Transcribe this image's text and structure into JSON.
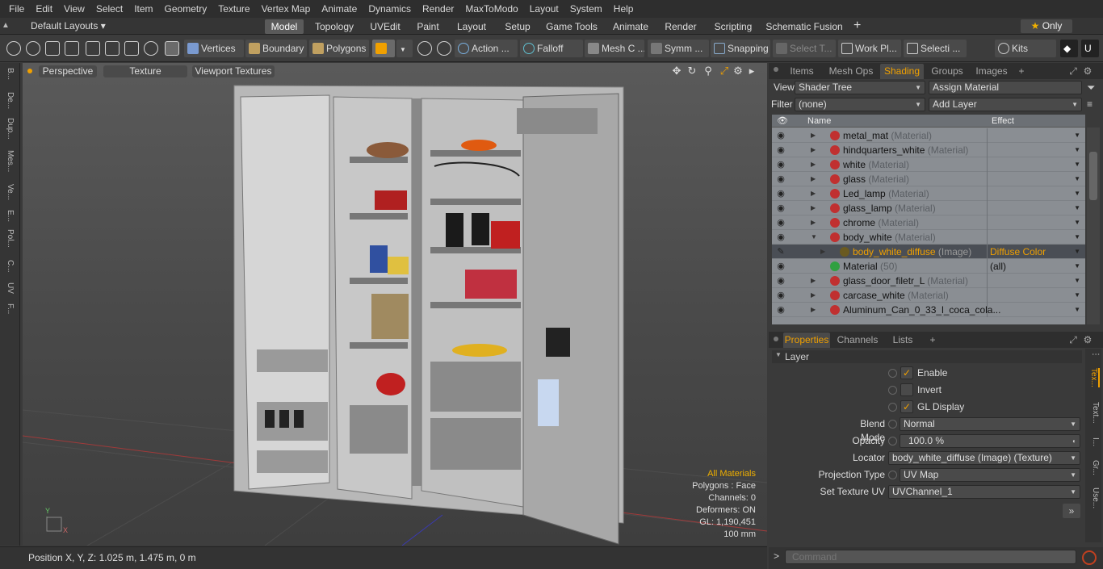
{
  "menu": [
    "File",
    "Edit",
    "View",
    "Select",
    "Item",
    "Geometry",
    "Texture",
    "Vertex Map",
    "Animate",
    "Dynamics",
    "Render",
    "MaxToModo",
    "Layout",
    "System",
    "Help"
  ],
  "layout": {
    "default_label": "Default Layouts ▾",
    "tabs": [
      "Model",
      "Topology",
      "UVEdit",
      "Paint",
      "Layout",
      "Setup",
      "Game Tools",
      "Animate",
      "Render",
      "Scripting",
      "Schematic Fusion"
    ],
    "active_tab": "Model",
    "only_label": "Only"
  },
  "toolbar": {
    "vertices": "Vertices",
    "boundary": "Boundary",
    "polygons": "Polygons",
    "action": "Action",
    "falloff": "Falloff",
    "mesh": "Mesh C ...",
    "symm": "Symm ...",
    "snapping": "Snapping",
    "select_t": "Select T...",
    "work_pl": "Work Pl...",
    "selecti": "Selecti ...",
    "kits": "Kits"
  },
  "left_tabs": [
    "B...",
    "De...",
    "Dup...",
    "Mes...",
    "Ve...",
    "E...",
    "Pol...",
    "C...",
    "UV",
    "F..."
  ],
  "viewport": {
    "perspective": "Perspective",
    "texture": "Texture",
    "viewport_textures": "Viewport Textures",
    "stats": {
      "all_materials": "All Materials",
      "polygons": "Polygons : Face",
      "channels": "Channels: 0",
      "deformers": "Deformers: ON",
      "gl": "GL: 1,190,451",
      "unit": "100 mm"
    }
  },
  "status": {
    "position": "Position X, Y, Z:   1.025 m, 1.475 m, 0 m"
  },
  "shading_panel": {
    "tabs": [
      "Items",
      "Mesh Ops",
      "Shading",
      "Groups",
      "Images"
    ],
    "active_tab": "Shading",
    "view_label": "View",
    "view_value": "Shader Tree",
    "assign_material": "Assign Material",
    "filter_label": "Filter",
    "filter_value": "(none)",
    "add_layer": "Add Layer",
    "col_name": "Name",
    "col_effect": "Effect",
    "rows": [
      {
        "name": "metal_mat",
        "type": "(Material)",
        "effect": "",
        "color": "#c03030"
      },
      {
        "name": "hindquarters_white",
        "type": "(Material)",
        "effect": "",
        "color": "#c03030"
      },
      {
        "name": "white",
        "type": "(Material)",
        "effect": "",
        "color": "#c03030"
      },
      {
        "name": "glass",
        "type": "(Material)",
        "effect": "",
        "color": "#c03030"
      },
      {
        "name": "Led_lamp",
        "type": "(Material)",
        "effect": "",
        "color": "#c03030"
      },
      {
        "name": "glass_lamp",
        "type": "(Material)",
        "effect": "",
        "color": "#c03030"
      },
      {
        "name": "chrome",
        "type": "(Material)",
        "effect": "",
        "color": "#c03030"
      },
      {
        "name": "body_white",
        "type": "(Material)",
        "effect": "",
        "color": "#c03030"
      },
      {
        "name": "body_white_diffuse",
        "type": "(Image)",
        "effect": "Diffuse Color",
        "color": "#6a5a20"
      },
      {
        "name": "Material",
        "type": "(50)",
        "effect": "(all)",
        "color": "#30a040"
      },
      {
        "name": "glass_door_filetr_L",
        "type": "(Material)",
        "effect": "",
        "color": "#c03030"
      },
      {
        "name": "carcase_white",
        "type": "(Material)",
        "effect": "",
        "color": "#c03030"
      },
      {
        "name": "Aluminum_Can_0_33_l_coca_cola...",
        "type": "",
        "effect": "",
        "color": "#c03030"
      }
    ]
  },
  "properties_panel": {
    "tabs": [
      "Properties",
      "Channels",
      "Lists"
    ],
    "active_tab": "Properties",
    "section": "Layer",
    "enable": "Enable",
    "invert": "Invert",
    "gl_display": "GL Display",
    "blend_mode_label": "Blend Mode",
    "blend_mode": "Normal",
    "opacity_label": "Opacity",
    "opacity": "100.0 %",
    "locator_label": "Locator",
    "locator": "body_white_diffuse (Image) (Texture)",
    "projection_label": "Projection Type",
    "projection": "UV Map",
    "uv_label": "Set Texture UV",
    "uv": "UVChannel_1",
    "side_tabs": [
      "Tex...",
      "Text...",
      "I...",
      "Gr...",
      "Use..."
    ]
  },
  "command": {
    "placeholder": "Command"
  },
  "colors": {
    "accent": "#f0a000",
    "selected_row": "#4a4e55"
  }
}
